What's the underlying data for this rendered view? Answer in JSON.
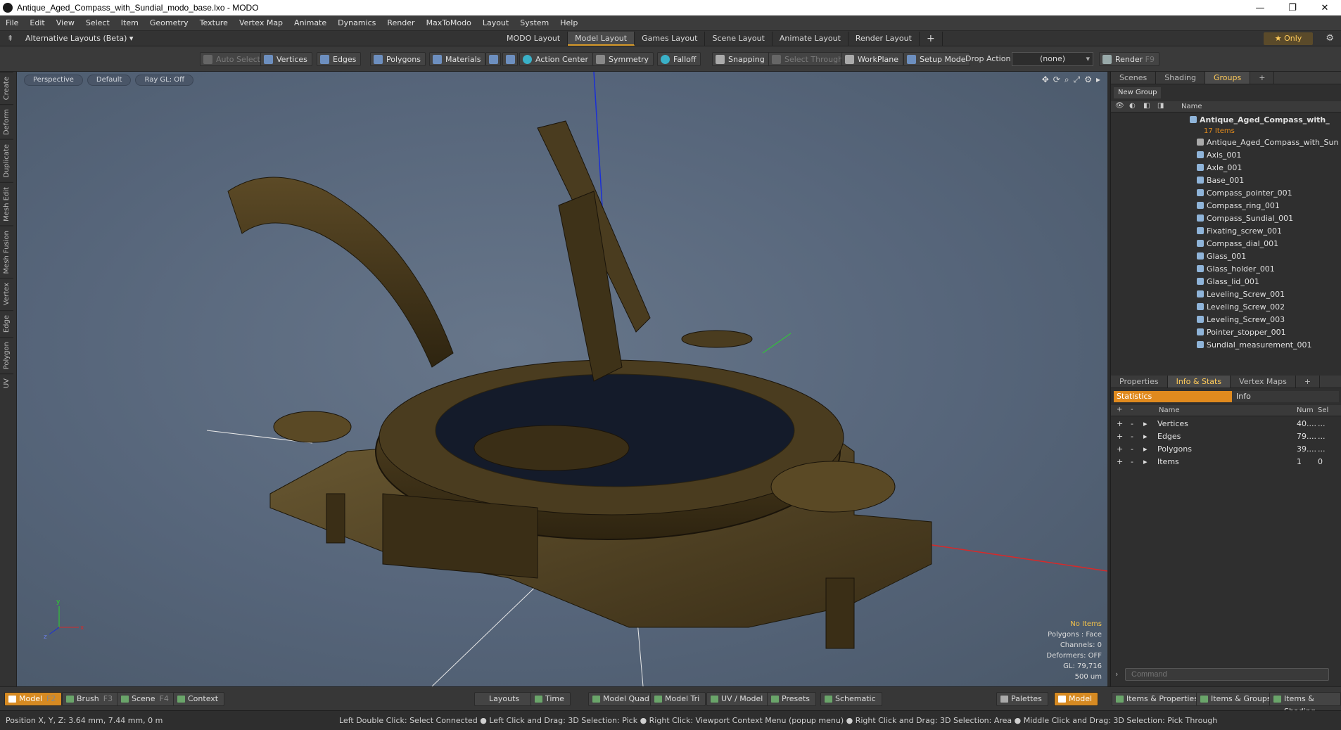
{
  "window": {
    "title": "Antique_Aged_Compass_with_Sundial_modo_base.lxo - MODO",
    "controls": [
      "—",
      "❐",
      "✕"
    ]
  },
  "menu": [
    "File",
    "Edit",
    "View",
    "Select",
    "Item",
    "Geometry",
    "Texture",
    "Vertex Map",
    "Animate",
    "Dynamics",
    "Render",
    "MaxToModo",
    "Layout",
    "System",
    "Help"
  ],
  "layout_bar": {
    "alt_layouts": "Alternative Layouts (Beta) ▾",
    "tabs": [
      "MODO Layout",
      "Model Layout",
      "Games Layout",
      "Scene Layout",
      "Animate Layout",
      "Render Layout"
    ],
    "active_tab": "Model Layout",
    "add": "+",
    "only": "★  Only"
  },
  "toolbar": {
    "auto_select": "Auto Select",
    "vertices": "Vertices",
    "edges": "Edges",
    "polygons": "Polygons",
    "materials": "Materials",
    "action_center": "Action Center",
    "symmetry": "Symmetry",
    "falloff": "Falloff",
    "snapping": "Snapping",
    "select_through": "Select Through",
    "workplane": "WorkPlane",
    "setup_mode": "Setup Mode",
    "drop_action": "Drop Action",
    "drop_value": "(none)",
    "render": "Render",
    "render_key": "F9"
  },
  "left_tabs": [
    "Create",
    "Deform",
    "Duplicate",
    "Mesh Edit",
    "Mesh Fusion",
    "Vertex",
    "Edge",
    "Polygon",
    "UV"
  ],
  "viewport": {
    "view": "Perspective",
    "shading": "Default",
    "raygl": "Ray GL: Off",
    "stats": {
      "selection": "No Items",
      "polygons": "Polygons : Face",
      "channels": "Channels: 0",
      "deformers": "Deformers: OFF",
      "gl": "GL: 79,716",
      "scale": "500 um"
    },
    "axis_x": "x",
    "axis_y": "y",
    "axis_z": "z"
  },
  "scene_panel": {
    "tabs": [
      "Scenes",
      "Shading",
      "Groups"
    ],
    "active_tab": "Groups",
    "new_group": "New Group",
    "name_header": "Name",
    "group_name": "Antique_Aged_Compass_with_",
    "group_count": "17 Items",
    "items": [
      "Antique_Aged_Compass_with_Sun ...",
      "Axis_001",
      "Axle_001",
      "Base_001",
      "Compass_pointer_001",
      "Compass_ring_001",
      "Compass_Sundial_001",
      "Fixating_screw_001",
      "Compass_dial_001",
      "Glass_001",
      "Glass_holder_001",
      "Glass_lid_001",
      "Leveling_Screw_001",
      "Leveling_Screw_002",
      "Leveling_Screw_003",
      "Pointer_stopper_001",
      "Sundial_measurement_001"
    ]
  },
  "info_panel": {
    "tabs": [
      "Properties",
      "Info & Stats",
      "Vertex Maps"
    ],
    "active_tab": "Info & Stats",
    "statistics": "Statistics",
    "info": "Info",
    "headers": {
      "name": "Name",
      "num": "Num",
      "sel": "Sel"
    },
    "rows": [
      {
        "name": "Vertices",
        "num": "40....",
        "sel": "..."
      },
      {
        "name": "Edges",
        "num": "79....",
        "sel": "..."
      },
      {
        "name": "Polygons",
        "num": "39....",
        "sel": "..."
      },
      {
        "name": "Items",
        "num": "1",
        "sel": "0"
      }
    ],
    "command_placeholder": "Command"
  },
  "bottom_bar": {
    "model": "Model",
    "model_key": "F2",
    "brush": "Brush",
    "brush_key": "F3",
    "scene": "Scene",
    "scene_key": "F4",
    "context": "Context",
    "layouts": "Layouts",
    "time": "Time",
    "model_quad": "Model Quad",
    "model_tri": "Model Tri",
    "uv_model": "UV / Model",
    "presets": "Presets",
    "schematic": "Schematic",
    "palettes": "Palettes",
    "model_right": "Model",
    "items_properties": "Items & Properties",
    "items_groups": "Items & Groups",
    "items_shading": "Items & Shading"
  },
  "status": {
    "position": "Position X, Y, Z:   3.64 mm, 7.44 mm, 0 m",
    "hint": "Left Double Click: Select Connected ● Left Click and Drag: 3D Selection: Pick ● Right Click: Viewport Context Menu (popup menu) ● Right Click and Drag: 3D Selection: Area ● Middle Click and Drag: 3D Selection: Pick Through"
  },
  "colors": {
    "accent": "#e08a1e",
    "viewport_bg": "#5a697d",
    "mesh_dark": "#3a2e17",
    "mesh_light": "#6b5a33"
  }
}
